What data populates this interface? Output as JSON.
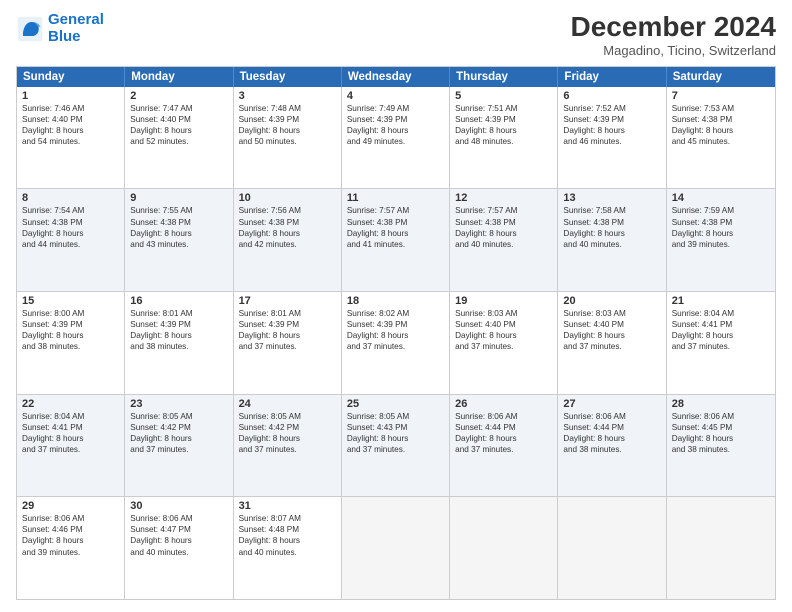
{
  "logo": {
    "line1": "General",
    "line2": "Blue"
  },
  "title": "December 2024",
  "subtitle": "Magadino, Ticino, Switzerland",
  "calendar": {
    "headers": [
      "Sunday",
      "Monday",
      "Tuesday",
      "Wednesday",
      "Thursday",
      "Friday",
      "Saturday"
    ],
    "rows": [
      [
        {
          "day": "1",
          "lines": [
            "Sunrise: 7:46 AM",
            "Sunset: 4:40 PM",
            "Daylight: 8 hours",
            "and 54 minutes."
          ]
        },
        {
          "day": "2",
          "lines": [
            "Sunrise: 7:47 AM",
            "Sunset: 4:40 PM",
            "Daylight: 8 hours",
            "and 52 minutes."
          ]
        },
        {
          "day": "3",
          "lines": [
            "Sunrise: 7:48 AM",
            "Sunset: 4:39 PM",
            "Daylight: 8 hours",
            "and 50 minutes."
          ]
        },
        {
          "day": "4",
          "lines": [
            "Sunrise: 7:49 AM",
            "Sunset: 4:39 PM",
            "Daylight: 8 hours",
            "and 49 minutes."
          ]
        },
        {
          "day": "5",
          "lines": [
            "Sunrise: 7:51 AM",
            "Sunset: 4:39 PM",
            "Daylight: 8 hours",
            "and 48 minutes."
          ]
        },
        {
          "day": "6",
          "lines": [
            "Sunrise: 7:52 AM",
            "Sunset: 4:39 PM",
            "Daylight: 8 hours",
            "and 46 minutes."
          ]
        },
        {
          "day": "7",
          "lines": [
            "Sunrise: 7:53 AM",
            "Sunset: 4:38 PM",
            "Daylight: 8 hours",
            "and 45 minutes."
          ]
        }
      ],
      [
        {
          "day": "8",
          "lines": [
            "Sunrise: 7:54 AM",
            "Sunset: 4:38 PM",
            "Daylight: 8 hours",
            "and 44 minutes."
          ]
        },
        {
          "day": "9",
          "lines": [
            "Sunrise: 7:55 AM",
            "Sunset: 4:38 PM",
            "Daylight: 8 hours",
            "and 43 minutes."
          ]
        },
        {
          "day": "10",
          "lines": [
            "Sunrise: 7:56 AM",
            "Sunset: 4:38 PM",
            "Daylight: 8 hours",
            "and 42 minutes."
          ]
        },
        {
          "day": "11",
          "lines": [
            "Sunrise: 7:57 AM",
            "Sunset: 4:38 PM",
            "Daylight: 8 hours",
            "and 41 minutes."
          ]
        },
        {
          "day": "12",
          "lines": [
            "Sunrise: 7:57 AM",
            "Sunset: 4:38 PM",
            "Daylight: 8 hours",
            "and 40 minutes."
          ]
        },
        {
          "day": "13",
          "lines": [
            "Sunrise: 7:58 AM",
            "Sunset: 4:38 PM",
            "Daylight: 8 hours",
            "and 40 minutes."
          ]
        },
        {
          "day": "14",
          "lines": [
            "Sunrise: 7:59 AM",
            "Sunset: 4:38 PM",
            "Daylight: 8 hours",
            "and 39 minutes."
          ]
        }
      ],
      [
        {
          "day": "15",
          "lines": [
            "Sunrise: 8:00 AM",
            "Sunset: 4:39 PM",
            "Daylight: 8 hours",
            "and 38 minutes."
          ]
        },
        {
          "day": "16",
          "lines": [
            "Sunrise: 8:01 AM",
            "Sunset: 4:39 PM",
            "Daylight: 8 hours",
            "and 38 minutes."
          ]
        },
        {
          "day": "17",
          "lines": [
            "Sunrise: 8:01 AM",
            "Sunset: 4:39 PM",
            "Daylight: 8 hours",
            "and 37 minutes."
          ]
        },
        {
          "day": "18",
          "lines": [
            "Sunrise: 8:02 AM",
            "Sunset: 4:39 PM",
            "Daylight: 8 hours",
            "and 37 minutes."
          ]
        },
        {
          "day": "19",
          "lines": [
            "Sunrise: 8:03 AM",
            "Sunset: 4:40 PM",
            "Daylight: 8 hours",
            "and 37 minutes."
          ]
        },
        {
          "day": "20",
          "lines": [
            "Sunrise: 8:03 AM",
            "Sunset: 4:40 PM",
            "Daylight: 8 hours",
            "and 37 minutes."
          ]
        },
        {
          "day": "21",
          "lines": [
            "Sunrise: 8:04 AM",
            "Sunset: 4:41 PM",
            "Daylight: 8 hours",
            "and 37 minutes."
          ]
        }
      ],
      [
        {
          "day": "22",
          "lines": [
            "Sunrise: 8:04 AM",
            "Sunset: 4:41 PM",
            "Daylight: 8 hours",
            "and 37 minutes."
          ]
        },
        {
          "day": "23",
          "lines": [
            "Sunrise: 8:05 AM",
            "Sunset: 4:42 PM",
            "Daylight: 8 hours",
            "and 37 minutes."
          ]
        },
        {
          "day": "24",
          "lines": [
            "Sunrise: 8:05 AM",
            "Sunset: 4:42 PM",
            "Daylight: 8 hours",
            "and 37 minutes."
          ]
        },
        {
          "day": "25",
          "lines": [
            "Sunrise: 8:05 AM",
            "Sunset: 4:43 PM",
            "Daylight: 8 hours",
            "and 37 minutes."
          ]
        },
        {
          "day": "26",
          "lines": [
            "Sunrise: 8:06 AM",
            "Sunset: 4:44 PM",
            "Daylight: 8 hours",
            "and 37 minutes."
          ]
        },
        {
          "day": "27",
          "lines": [
            "Sunrise: 8:06 AM",
            "Sunset: 4:44 PM",
            "Daylight: 8 hours",
            "and 38 minutes."
          ]
        },
        {
          "day": "28",
          "lines": [
            "Sunrise: 8:06 AM",
            "Sunset: 4:45 PM",
            "Daylight: 8 hours",
            "and 38 minutes."
          ]
        }
      ],
      [
        {
          "day": "29",
          "lines": [
            "Sunrise: 8:06 AM",
            "Sunset: 4:46 PM",
            "Daylight: 8 hours",
            "and 39 minutes."
          ]
        },
        {
          "day": "30",
          "lines": [
            "Sunrise: 8:06 AM",
            "Sunset: 4:47 PM",
            "Daylight: 8 hours",
            "and 40 minutes."
          ]
        },
        {
          "day": "31",
          "lines": [
            "Sunrise: 8:07 AM",
            "Sunset: 4:48 PM",
            "Daylight: 8 hours",
            "and 40 minutes."
          ]
        },
        {
          "day": "",
          "lines": []
        },
        {
          "day": "",
          "lines": []
        },
        {
          "day": "",
          "lines": []
        },
        {
          "day": "",
          "lines": []
        }
      ]
    ]
  }
}
